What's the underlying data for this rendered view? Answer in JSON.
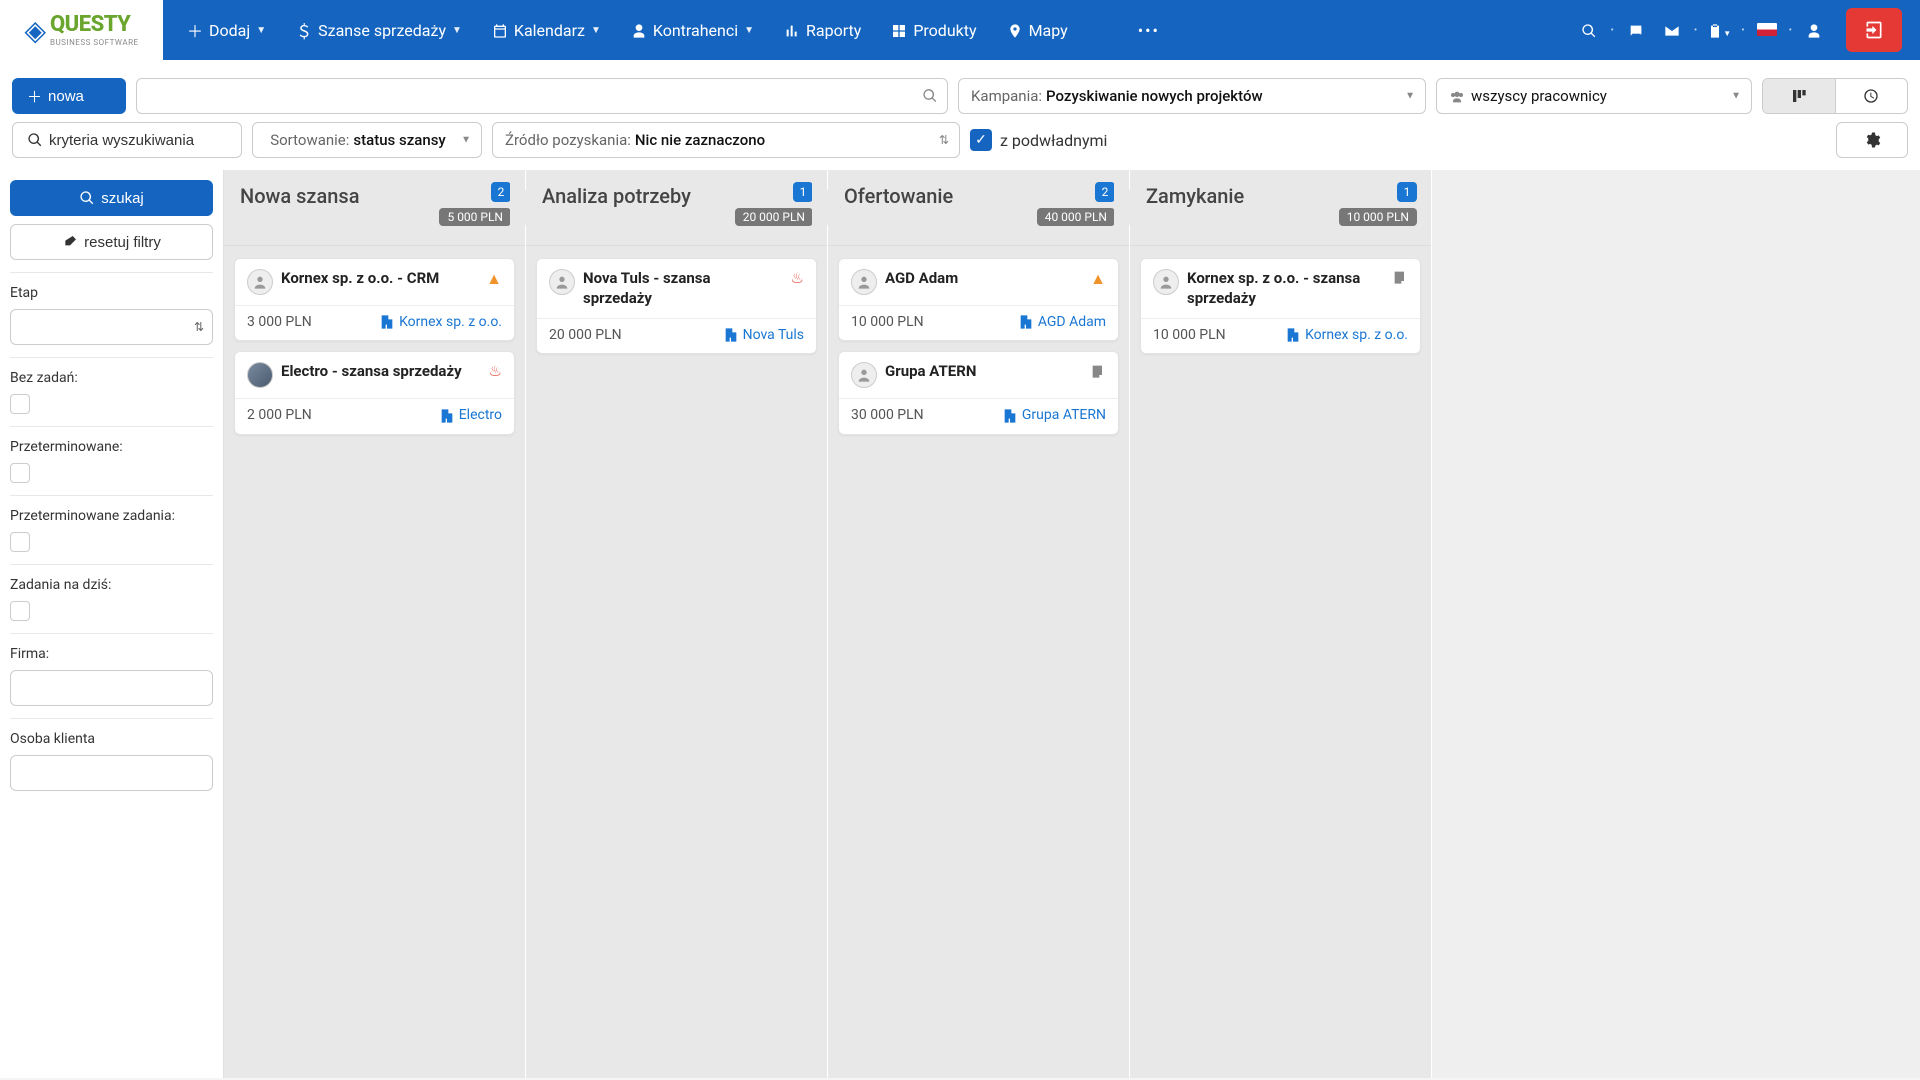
{
  "brand": {
    "name": "QUESTY",
    "sub": "BUSINESS SOFTWARE"
  },
  "nav": {
    "add": "Dodaj",
    "opportunities": "Szanse sprzedaży",
    "calendar": "Kalendarz",
    "contractors": "Kontrahenci",
    "reports": "Raporty",
    "products": "Produkty",
    "maps": "Mapy"
  },
  "toolbar": {
    "new_btn": "nowa",
    "campaign_label": "Kampania:",
    "campaign_value": "Pozyskiwanie nowych projektów",
    "employees_value": "wszyscy pracownicy",
    "criteria_btn": "kryteria wyszukiwania",
    "sort_label": "Sortowanie:",
    "sort_value": "status szansy",
    "source_label": "Źródło pozyskania:",
    "source_value": "Nic nie zaznaczono",
    "with_sub": "z podwładnymi"
  },
  "sidebar": {
    "search_btn": "szukaj",
    "reset_btn": "resetuj filtry",
    "stage_label": "Etap",
    "no_tasks_label": "Bez zadań:",
    "overdue_label": "Przeterminowane:",
    "overdue_tasks_label": "Przeterminowane zadania:",
    "today_label": "Zadania na dziś:",
    "company_label": "Firma:",
    "contact_label": "Osoba klienta"
  },
  "columns": [
    {
      "title": "Nowa szansa",
      "count": "2",
      "sum": "5 000 PLN",
      "cards": [
        {
          "title": "Kornex sp. z o.o. - CRM",
          "amount": "3 000 PLN",
          "company": "Kornex sp. z o.o.",
          "warn": true,
          "fire": false,
          "note": false,
          "avatar": "default"
        },
        {
          "title": "Electro - szansa sprzedaży",
          "amount": "2 000 PLN",
          "company": "Electro",
          "warn": false,
          "fire": true,
          "note": false,
          "avatar": "photo"
        }
      ]
    },
    {
      "title": "Analiza potrzeby",
      "count": "1",
      "sum": "20 000 PLN",
      "cards": [
        {
          "title": "Nova Tuls - szansa sprzedaży",
          "amount": "20 000 PLN",
          "company": "Nova Tuls",
          "warn": false,
          "fire": true,
          "note": false,
          "avatar": "default"
        }
      ]
    },
    {
      "title": "Ofertowanie",
      "count": "2",
      "sum": "40 000 PLN",
      "cards": [
        {
          "title": "AGD Adam",
          "amount": "10 000 PLN",
          "company": "AGD Adam",
          "warn": true,
          "fire": false,
          "note": false,
          "avatar": "default"
        },
        {
          "title": "Grupa ATERN",
          "amount": "30 000 PLN",
          "company": "Grupa ATERN",
          "warn": false,
          "fire": false,
          "note": true,
          "avatar": "default"
        }
      ]
    },
    {
      "title": "Zamykanie",
      "count": "1",
      "sum": "10 000 PLN",
      "cards": [
        {
          "title": "Kornex sp. z o.o. - szansa sprzedaży",
          "amount": "10 000 PLN",
          "company": "Kornex sp. z o.o.",
          "warn": false,
          "fire": false,
          "note": true,
          "avatar": "default"
        }
      ]
    }
  ]
}
